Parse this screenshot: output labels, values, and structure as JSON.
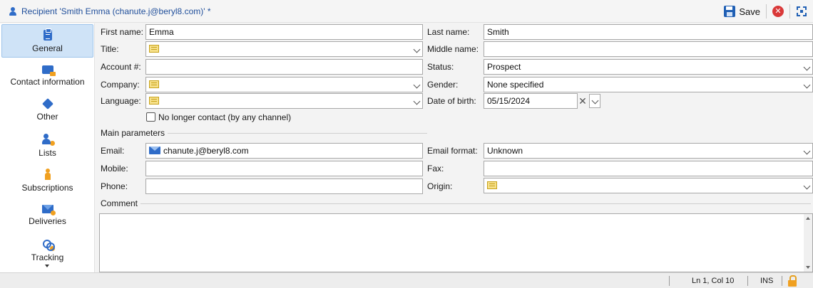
{
  "window": {
    "title": "Recipient 'Smith Emma (chanute.j@beryl8.com)' *",
    "save_label": "Save"
  },
  "sidebar": {
    "items": [
      {
        "label": "General",
        "icon": "clipboard-icon",
        "active": true
      },
      {
        "label": "Contact information",
        "icon": "contact-card-icon"
      },
      {
        "label": "Other",
        "icon": "cube-icon"
      },
      {
        "label": "Lists",
        "icon": "users-icon"
      },
      {
        "label": "Subscriptions",
        "icon": "person-icon"
      },
      {
        "label": "Deliveries",
        "icon": "mail-icon"
      },
      {
        "label": "Tracking",
        "icon": "link-icon"
      }
    ]
  },
  "form": {
    "first_name": {
      "label": "First name:",
      "value": "Emma"
    },
    "last_name": {
      "label": "Last name:",
      "value": "Smith"
    },
    "title": {
      "label": "Title:",
      "value": ""
    },
    "middle_name": {
      "label": "Middle name:",
      "value": ""
    },
    "account": {
      "label": "Account #:",
      "value": ""
    },
    "status": {
      "label": "Status:",
      "value": "Prospect"
    },
    "company": {
      "label": "Company:",
      "value": ""
    },
    "gender": {
      "label": "Gender:",
      "value": "None specified"
    },
    "language": {
      "label": "Language:",
      "value": ""
    },
    "date_of_birth": {
      "label": "Date of birth:",
      "value": "05/15/2024"
    },
    "no_longer_contact": {
      "label": "No longer contact (by any channel)",
      "checked": false
    },
    "main_parameters": "Main parameters",
    "email": {
      "label": "Email:",
      "value": "chanute.j@beryl8.com"
    },
    "email_format": {
      "label": "Email format:",
      "value": "Unknown"
    },
    "mobile": {
      "label": "Mobile:",
      "value": ""
    },
    "fax": {
      "label": "Fax:",
      "value": ""
    },
    "phone": {
      "label": "Phone:",
      "value": ""
    },
    "origin": {
      "label": "Origin:",
      "value": ""
    },
    "comment": {
      "label": "Comment",
      "value": ""
    }
  },
  "statusbar": {
    "position": "Ln 1, Col 10",
    "mode": "INS"
  },
  "colors": {
    "accent": "#2f6cc8",
    "title_text": "#1f4e9a",
    "active_tab_bg": "#cfe3f7",
    "lock": "#f0a020"
  }
}
